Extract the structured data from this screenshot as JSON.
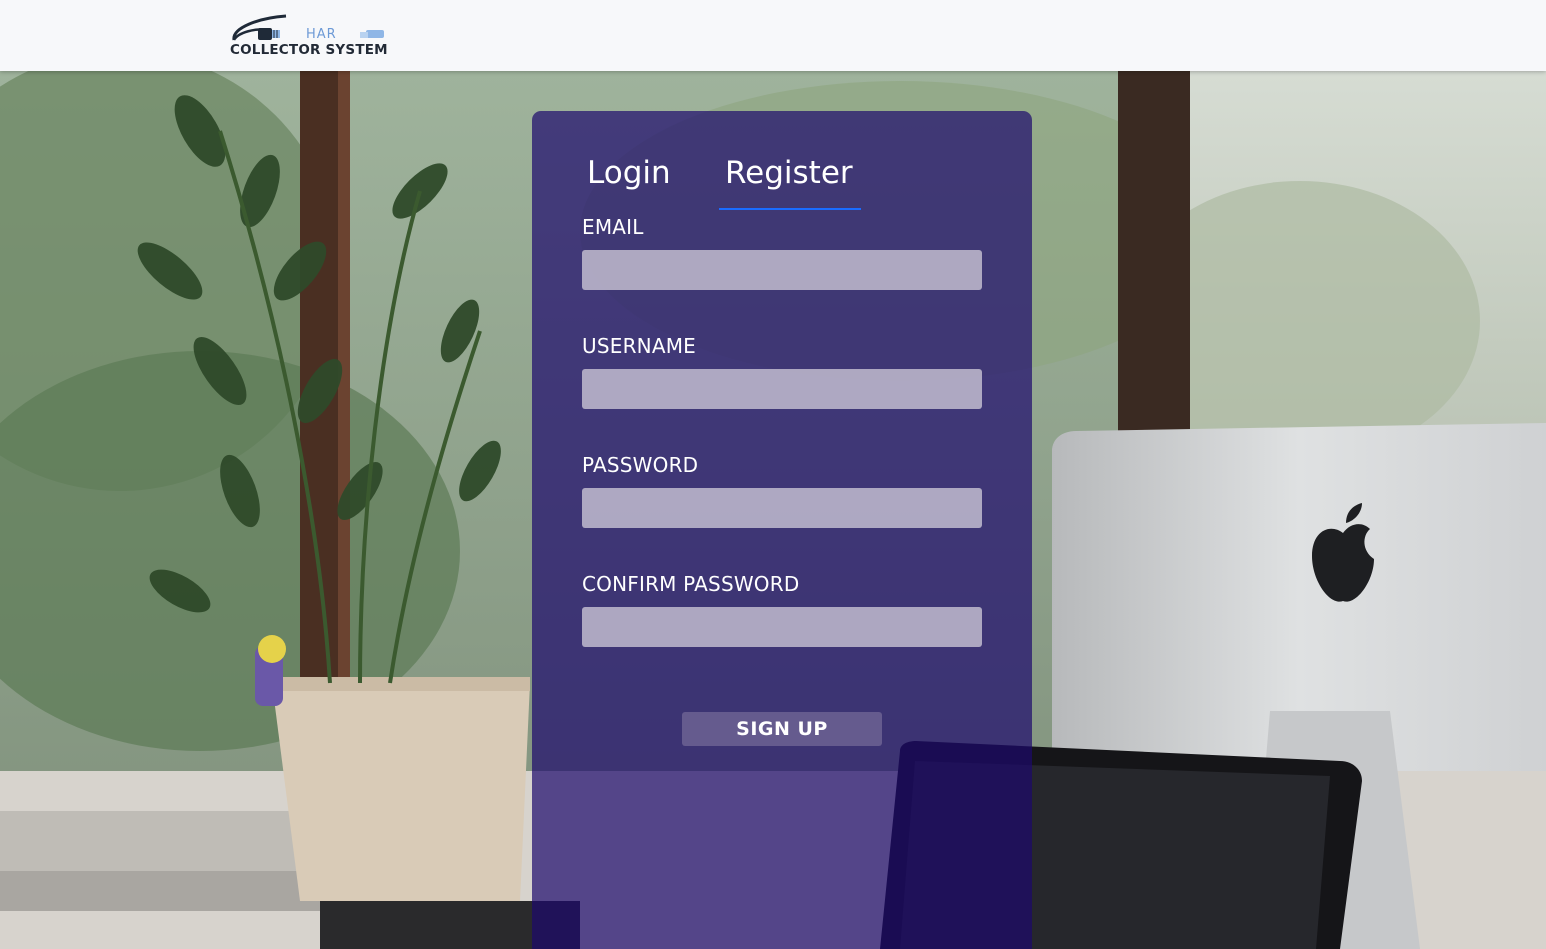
{
  "brand": {
    "name_top": "HAR",
    "name_bottom": "COLLECTOR SYSTEM"
  },
  "tabs": [
    {
      "label": "Login",
      "active": false
    },
    {
      "label": "Register",
      "active": true
    }
  ],
  "form": {
    "fields": [
      {
        "label": "EMAIL",
        "value": "",
        "type": "email"
      },
      {
        "label": "USERNAME",
        "value": "",
        "type": "text"
      },
      {
        "label": "PASSWORD",
        "value": "",
        "type": "password"
      },
      {
        "label": "CONFIRM PASSWORD",
        "value": "",
        "type": "password"
      }
    ],
    "submit_label": "SIGN UP"
  },
  "colors": {
    "panel": "#1c086c",
    "tab_underline": "#1a6cff",
    "navbar": "#f7f8fa"
  }
}
